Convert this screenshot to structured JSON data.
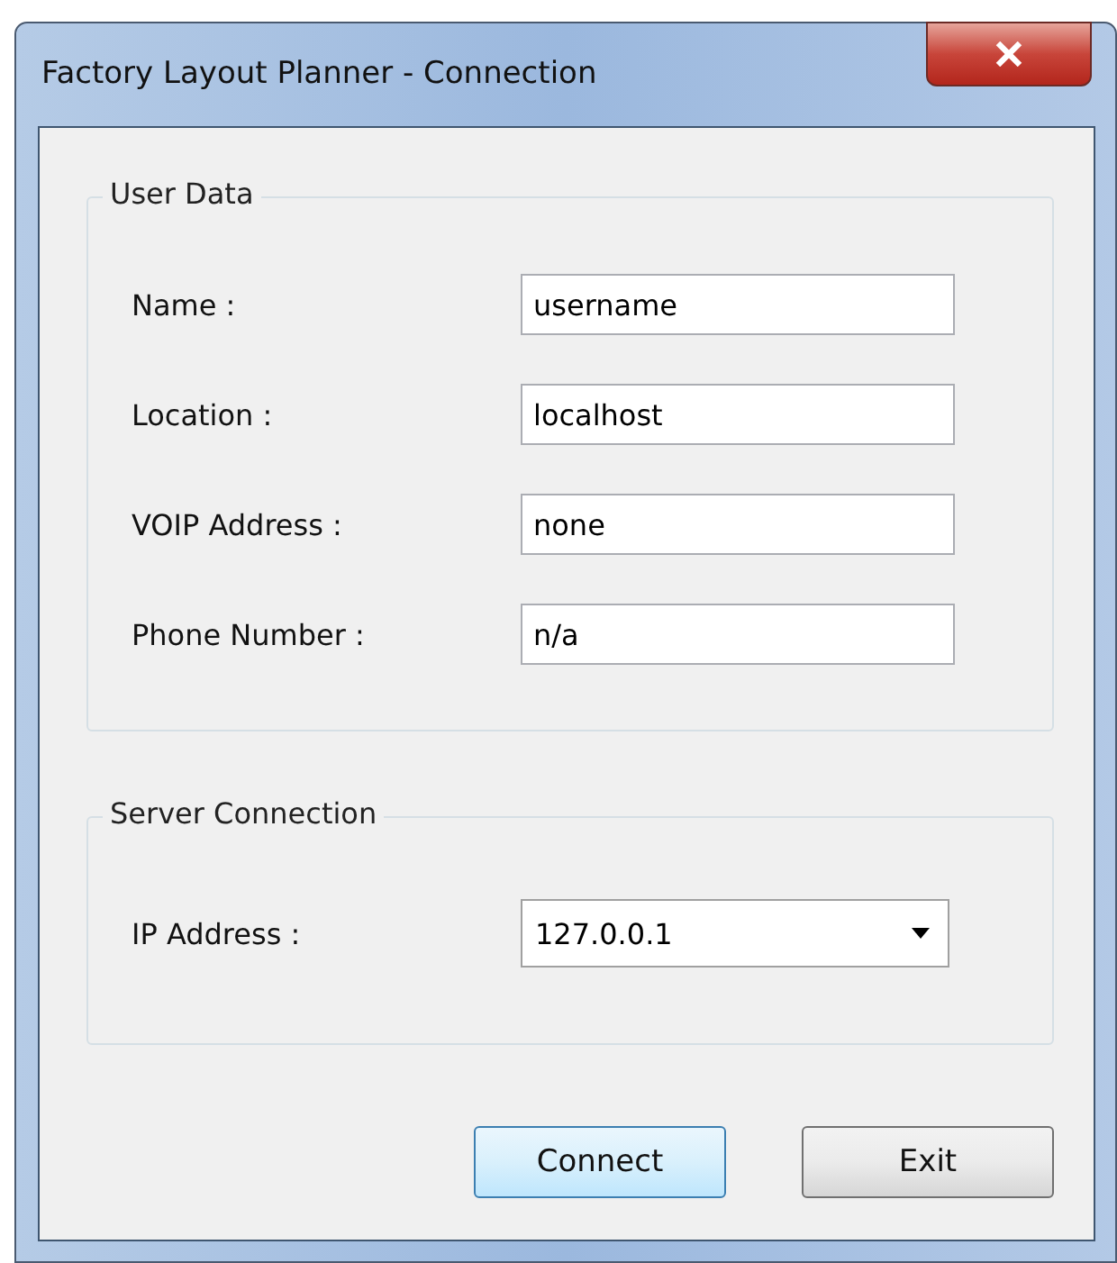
{
  "window": {
    "title": "Factory Layout Planner - Connection"
  },
  "user_data": {
    "title": "User Data",
    "fields": [
      {
        "label": "Name :",
        "value": "username"
      },
      {
        "label": "Location :",
        "value": "localhost"
      },
      {
        "label": "VOIP Address :",
        "value": "none"
      },
      {
        "label": "Phone Number :",
        "value": "n/a"
      }
    ]
  },
  "server_connection": {
    "title": "Server Connection",
    "fields": [
      {
        "label": "IP Address :",
        "value": "127.0.0.1"
      }
    ]
  },
  "buttons": [
    {
      "label": "Connect",
      "kind": "default"
    },
    {
      "label": "Exit",
      "kind": "normal"
    }
  ]
}
